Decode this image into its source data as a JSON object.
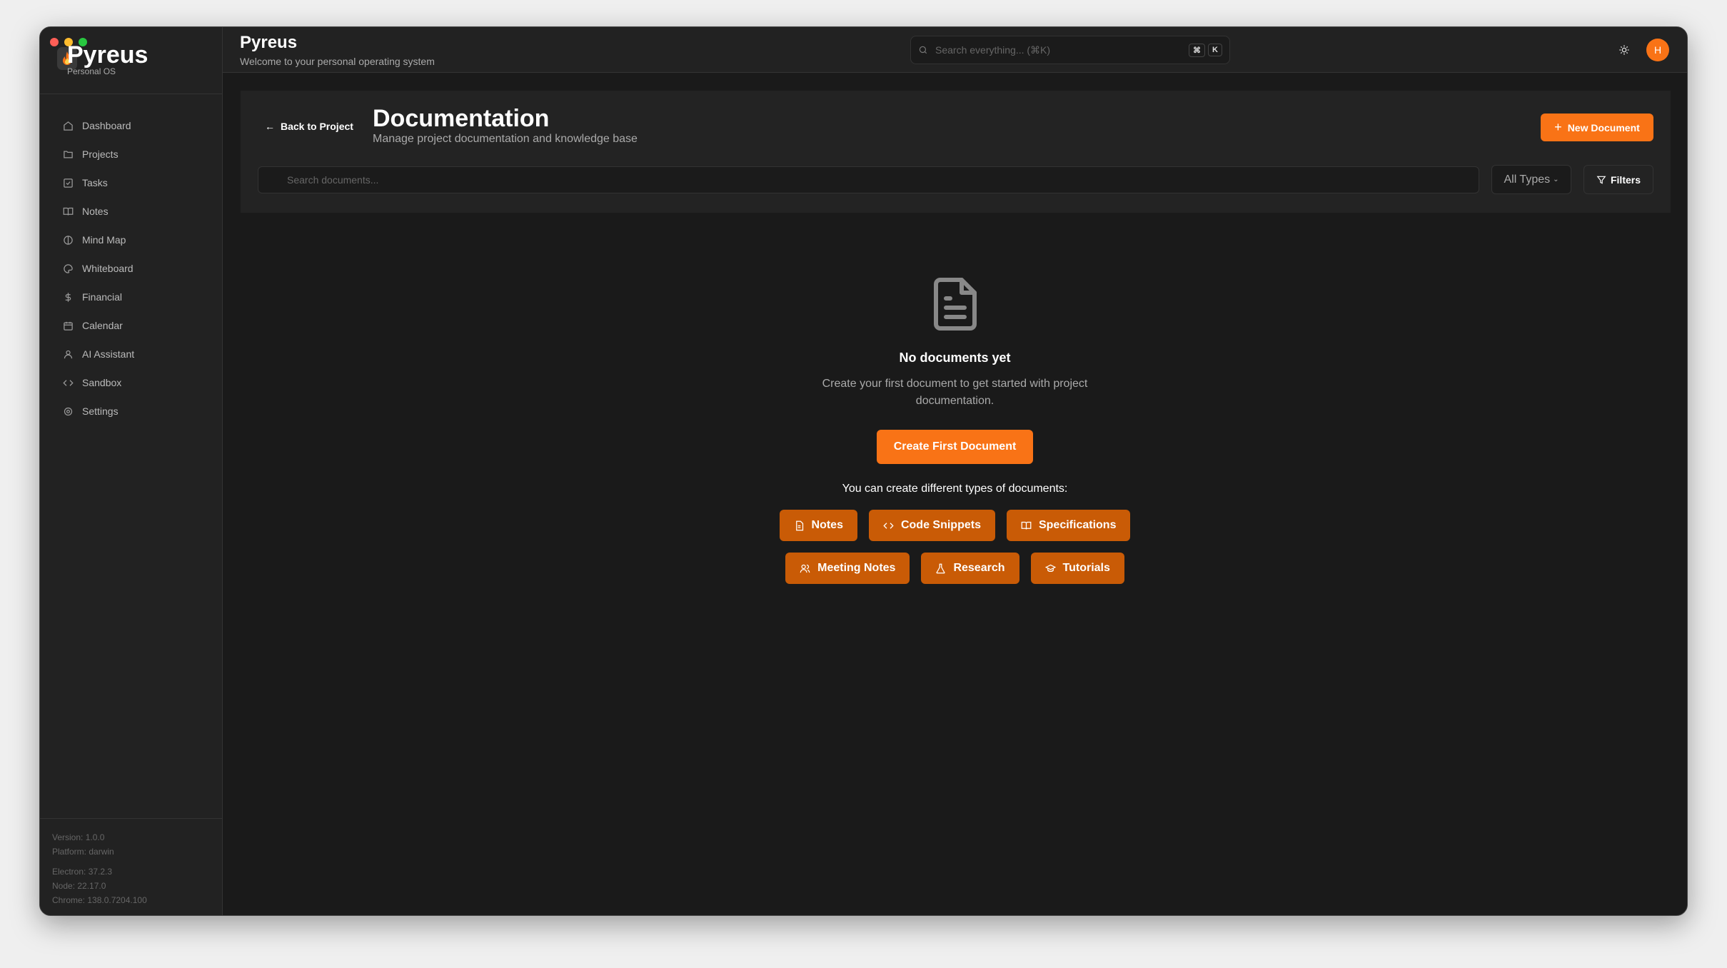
{
  "app": {
    "name": "Pyreus",
    "tagline": "Personal OS"
  },
  "sidebar": {
    "items": [
      {
        "label": "Dashboard",
        "icon": "home-icon"
      },
      {
        "label": "Projects",
        "icon": "folder-icon"
      },
      {
        "label": "Tasks",
        "icon": "checkbox-icon"
      },
      {
        "label": "Notes",
        "icon": "book-icon"
      },
      {
        "label": "Mind Map",
        "icon": "brain-icon"
      },
      {
        "label": "Whiteboard",
        "icon": "palette-icon"
      },
      {
        "label": "Financial",
        "icon": "dollar-icon"
      },
      {
        "label": "Calendar",
        "icon": "calendar-icon"
      },
      {
        "label": "AI Assistant",
        "icon": "user-icon"
      },
      {
        "label": "Sandbox",
        "icon": "code-icon"
      },
      {
        "label": "Settings",
        "icon": "gear-icon"
      }
    ],
    "footer": {
      "version": "Version: 1.0.0",
      "platform": "Platform: darwin",
      "electron": "Electron: 37.2.3",
      "node": "Node: 22.17.0",
      "chrome": "Chrome: 138.0.7204.100"
    }
  },
  "header": {
    "title": "Pyreus",
    "subtitle": "Welcome to your personal operating system",
    "search_placeholder": "Search everything... (⌘K)",
    "kbd1": "⌘",
    "kbd2": "K",
    "avatar": "H"
  },
  "page": {
    "back": "Back to Project",
    "title": "Documentation",
    "subtitle": "Manage project documentation and knowledge base",
    "new_button": "New Document",
    "search_placeholder": "Search documents...",
    "type_filter": "All Types",
    "filters": "Filters"
  },
  "empty": {
    "title": "No documents yet",
    "description": "Create your first document to get started with project documentation.",
    "create_button": "Create First Document",
    "caption": "You can create different types of documents:",
    "types_row1": [
      "Notes",
      "Code Snippets",
      "Specifications"
    ],
    "types_row2": [
      "Meeting Notes",
      "Research",
      "Tutorials"
    ]
  },
  "colors": {
    "accent": "#f97316",
    "chip": "#c95b06",
    "background": "#1a1a1a"
  }
}
